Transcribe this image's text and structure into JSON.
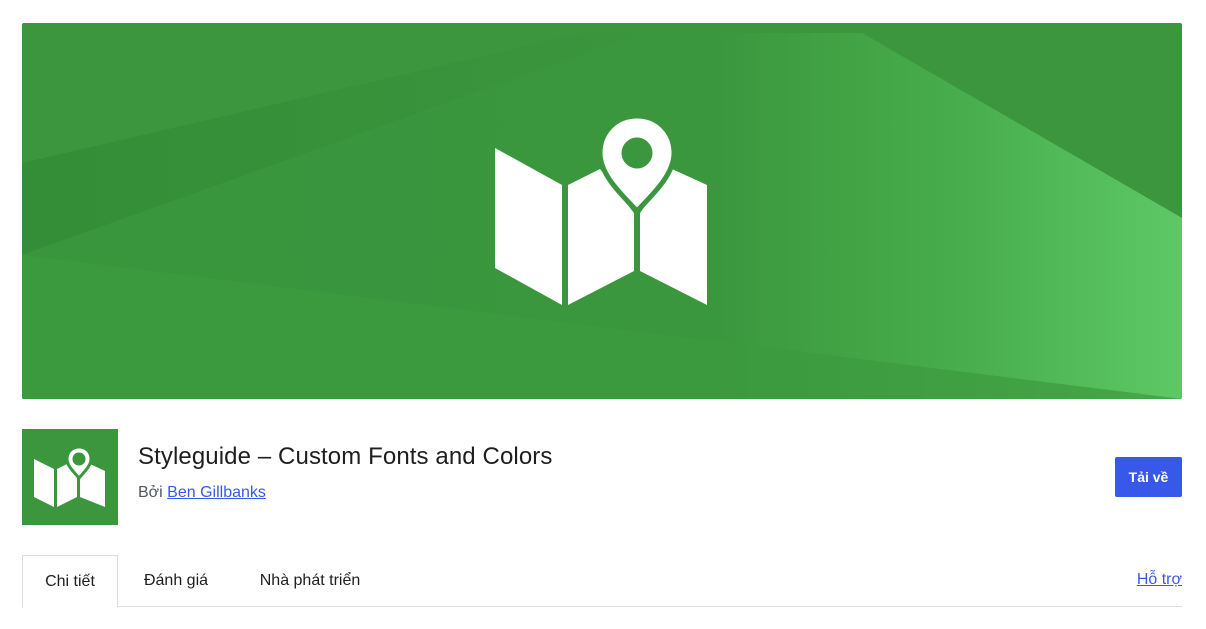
{
  "plugin": {
    "title": "Styleguide – Custom Fonts and Colors",
    "by_prefix": "Bởi",
    "author": "Ben Gillbanks",
    "download_label": "Tải về",
    "icon": "map-pin-icon"
  },
  "banner": {
    "icon": "folded-map-with-pin-icon",
    "colors": {
      "base": "#3b963e",
      "dark": "#338a37",
      "light": "#5cc563"
    }
  },
  "tabs": [
    {
      "label": "Chi tiết",
      "active": true
    },
    {
      "label": "Đánh giá",
      "active": false
    },
    {
      "label": "Nhà phát triển",
      "active": false
    }
  ],
  "support_link": "Hỗ trợ",
  "colors": {
    "accent": "#3858e9",
    "border": "#dcdcde",
    "text": "#1e1e1e",
    "muted": "#50575e"
  }
}
